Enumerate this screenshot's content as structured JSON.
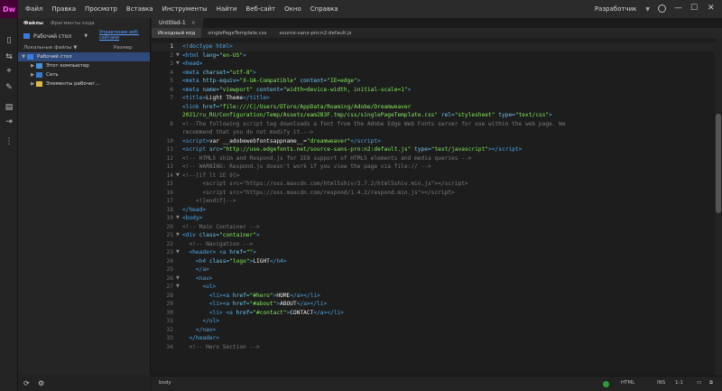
{
  "app": {
    "logo": "Dw",
    "menus": [
      "Файл",
      "Правка",
      "Просмотр",
      "Вставка",
      "Инструменты",
      "Найти",
      "Веб-сайт",
      "Окно",
      "Справка"
    ],
    "workspace": "Разработчик",
    "icons": {
      "search": "search-icon",
      "minimize": "minimize-icon",
      "maximize": "maximize-icon",
      "close": "close-icon"
    },
    "accent": "#470137"
  },
  "files_panel": {
    "tabs": [
      "Файлы",
      "Фрагменты кода"
    ],
    "location": "Рабочий стол",
    "manage_link": "Управление веб-сайтами",
    "header_name": "Локальные файлы ▼",
    "header_size": "Размер",
    "tree": [
      {
        "label": "Рабочий стол",
        "level": 0,
        "expanded": true,
        "selected": true,
        "icon": "desktop-icon"
      },
      {
        "label": "Этот компьютер",
        "level": 1,
        "expanded": false,
        "icon": "computer-icon"
      },
      {
        "label": "Сеть",
        "level": 1,
        "expanded": false,
        "icon": "network-icon"
      },
      {
        "label": "Элементы рабочег...",
        "level": 1,
        "expanded": false,
        "icon": "folder-icon"
      }
    ]
  },
  "document": {
    "tab_title": "Untitled-1",
    "related_tabs": [
      "Исходный код",
      "singlePageTemplate.css",
      "source-sans-pro:n2:default.js"
    ]
  },
  "status": {
    "tag": "body",
    "mode": "HTML",
    "ins": "INS",
    "position": "1:1"
  },
  "code_lines": [
    {
      "n": "1",
      "fold": "",
      "html": "<span class='c-tg'>&lt;!doctype html&gt;</span>"
    },
    {
      "n": "2",
      "fold": "▼",
      "html": "<span class='c-tg'>&lt;html</span> <span class='c-at'>lang=</span><span class='c-st'>\"en-US\"</span><span class='c-tg'>&gt;</span>"
    },
    {
      "n": "3",
      "fold": "▼",
      "html": "<span class='c-tg'>&lt;head&gt;</span>"
    },
    {
      "n": "4",
      "fold": "",
      "html": "<span class='c-tg'>&lt;meta</span> <span class='c-at'>charset=</span><span class='c-st'>\"utf-8\"</span><span class='c-tg'>&gt;</span>"
    },
    {
      "n": "5",
      "fold": "",
      "html": "<span class='c-tg'>&lt;meta</span> <span class='c-at'>http-equiv=</span><span class='c-st'>\"X-UA-Compatible\"</span> <span class='c-at'>content=</span><span class='c-st'>\"IE=edge\"</span><span class='c-tg'>&gt;</span>"
    },
    {
      "n": "6",
      "fold": "",
      "html": "<span class='c-tg'>&lt;meta</span> <span class='c-at'>name=</span><span class='c-st'>\"viewport\"</span> <span class='c-at'>content=</span><span class='c-st'>\"width=device-width, initial-scale=1\"</span><span class='c-tg'>&gt;</span>"
    },
    {
      "n": "7",
      "fold": "",
      "html": "<span class='c-tg'>&lt;title&gt;</span><span class='c-tx'>Light Theme</span><span class='c-tg'>&lt;/title&gt;</span>"
    },
    {
      "n": "",
      "fold": "",
      "html": "<span class='c-tg'>&lt;link</span> <span class='c-at'>href=</span><span class='c-st'>\"file:///C|/Users/DTore/AppData/Roaming/Adobe/Dreamweaver</span>"
    },
    {
      "n": "",
      "fold": "",
      "html": "<span class='c-st'>2021/ru_RU/Configuration/Temp/Assets/eam2B3F.tmp/css/singlePageTemplate.css\"</span> <span class='c-at'>rel=</span><span class='c-st'>\"stylesheet\"</span> <span class='c-at'>type=</span><span class='c-st'>\"text/css\"</span><span class='c-tg'>&gt;</span>"
    },
    {
      "n": "8",
      "fold": "",
      "html": "<span class='c-cm'>&lt;!--The following script tag downloads a font from the Adobe Edge Web Fonts server for use within the web page. We</span>"
    },
    {
      "n": "",
      "fold": "",
      "html": "<span class='c-cm'>recommend that you do not modify it.--&gt;</span>"
    },
    {
      "n": "10",
      "fold": "",
      "html": "<span class='c-tg'>&lt;script&gt;</span><span class='c-tx'>var __adobewebfontsappname__=</span><span class='c-st'>\"dreamweaver\"</span><span class='c-tg'>&lt;/script&gt;</span>"
    },
    {
      "n": "11",
      "fold": "",
      "html": "<span class='c-tg'>&lt;script</span> <span class='c-at'>src=</span><span class='c-st'>\"http://use.edgefonts.net/source-sans-pro:n2:default.js\"</span> <span class='c-at'>type=</span><span class='c-st'>\"text/javascript\"</span><span class='c-tg'>&gt;&lt;/script&gt;</span>"
    },
    {
      "n": "12",
      "fold": "",
      "html": "<span class='c-cm'>&lt;!-- HTML5 shim and Respond.js for IE8 support of HTML5 elements and media queries --&gt;</span>"
    },
    {
      "n": "13",
      "fold": "",
      "html": "<span class='c-cm'>&lt;!-- WARNING: Respond.js doesn't work if you view the page via file:// --&gt;</span>"
    },
    {
      "n": "14",
      "fold": "▼",
      "html": "<span class='c-cm'>&lt;!--[if lt IE 9]&gt;</span>"
    },
    {
      "n": "15",
      "fold": "",
      "html": "<span class='c-cm'>      &lt;script src=\"https://oss.maxcdn.com/html5shiv/3.7.2/html5shiv.min.js\"&gt;&lt;/script&gt;</span>"
    },
    {
      "n": "16",
      "fold": "",
      "html": "<span class='c-cm'>      &lt;script src=\"https://oss.maxcdn.com/respond/1.4.2/respond.min.js\"&gt;&lt;/script&gt;</span>"
    },
    {
      "n": "17",
      "fold": "",
      "html": "<span class='c-cm'>    &lt;![endif]--&gt;</span>"
    },
    {
      "n": "18",
      "fold": "",
      "html": "<span class='c-tg'>&lt;/head&gt;</span>"
    },
    {
      "n": "19",
      "fold": "▼",
      "html": "<span class='c-tg'>&lt;body&gt;</span>"
    },
    {
      "n": "20",
      "fold": "",
      "html": "<span class='c-cm'>&lt;!-- Main Container --&gt;</span>"
    },
    {
      "n": "21",
      "fold": "▼",
      "html": "<span class='c-tg'>&lt;div</span> <span class='c-at'>class=</span><span class='c-st'>\"container\"</span><span class='c-tg'>&gt;</span>"
    },
    {
      "n": "22",
      "fold": "",
      "html": "<span class='c-cm'>  &lt;!-- Navigation --&gt;</span>"
    },
    {
      "n": "23",
      "fold": "▼",
      "html": "  <span class='c-tg'>&lt;header&gt;</span> <span class='c-tg'>&lt;a</span> <span class='c-at'>href=</span><span class='c-st'>\"\"</span><span class='c-tg'>&gt;</span>"
    },
    {
      "n": "24",
      "fold": "",
      "html": "    <span class='c-tg'>&lt;h4</span> <span class='c-at'>class=</span><span class='c-st'>\"logo\"</span><span class='c-tg'>&gt;</span><span class='c-tx'>LIGHT</span><span class='c-tg'>&lt;/h4&gt;</span>"
    },
    {
      "n": "25",
      "fold": "",
      "html": "    <span class='c-tg'>&lt;/a&gt;</span>"
    },
    {
      "n": "26",
      "fold": "▼",
      "html": "    <span class='c-tg'>&lt;nav&gt;</span>"
    },
    {
      "n": "27",
      "fold": "▼",
      "html": "      <span class='c-tg'>&lt;ul&gt;</span>"
    },
    {
      "n": "28",
      "fold": "",
      "html": "        <span class='c-tg'>&lt;li&gt;&lt;a</span> <span class='c-at'>href=</span><span class='c-st'>\"#hero\"</span><span class='c-tg'>&gt;</span><span class='c-tx'>HOME</span><span class='c-tg'>&lt;/a&gt;&lt;/li&gt;</span>"
    },
    {
      "n": "29",
      "fold": "",
      "html": "        <span class='c-tg'>&lt;li&gt;&lt;a</span> <span class='c-at'>href=</span><span class='c-st'>\"#about\"</span><span class='c-tg'>&gt;</span><span class='c-tx'>ABOUT</span><span class='c-tg'>&lt;/a&gt;&lt;/li&gt;</span>"
    },
    {
      "n": "30",
      "fold": "",
      "html": "        <span class='c-tg'>&lt;li&gt;</span> <span class='c-tg'>&lt;a</span> <span class='c-at'>href=</span><span class='c-st'>\"#contact\"</span><span class='c-tg'>&gt;</span><span class='c-tx'>CONTACT</span><span class='c-tg'>&lt;/a&gt;&lt;/li&gt;</span>"
    },
    {
      "n": "31",
      "fold": "",
      "html": "      <span class='c-tg'>&lt;/ul&gt;</span>"
    },
    {
      "n": "32",
      "fold": "",
      "html": "    <span class='c-tg'>&lt;/nav&gt;</span>"
    },
    {
      "n": "33",
      "fold": "",
      "html": "  <span class='c-tg'>&lt;/header&gt;</span>"
    },
    {
      "n": "34",
      "fold": "",
      "html": "<span class='c-cm'>  &lt;!-- Hero Section --&gt;</span>"
    }
  ]
}
